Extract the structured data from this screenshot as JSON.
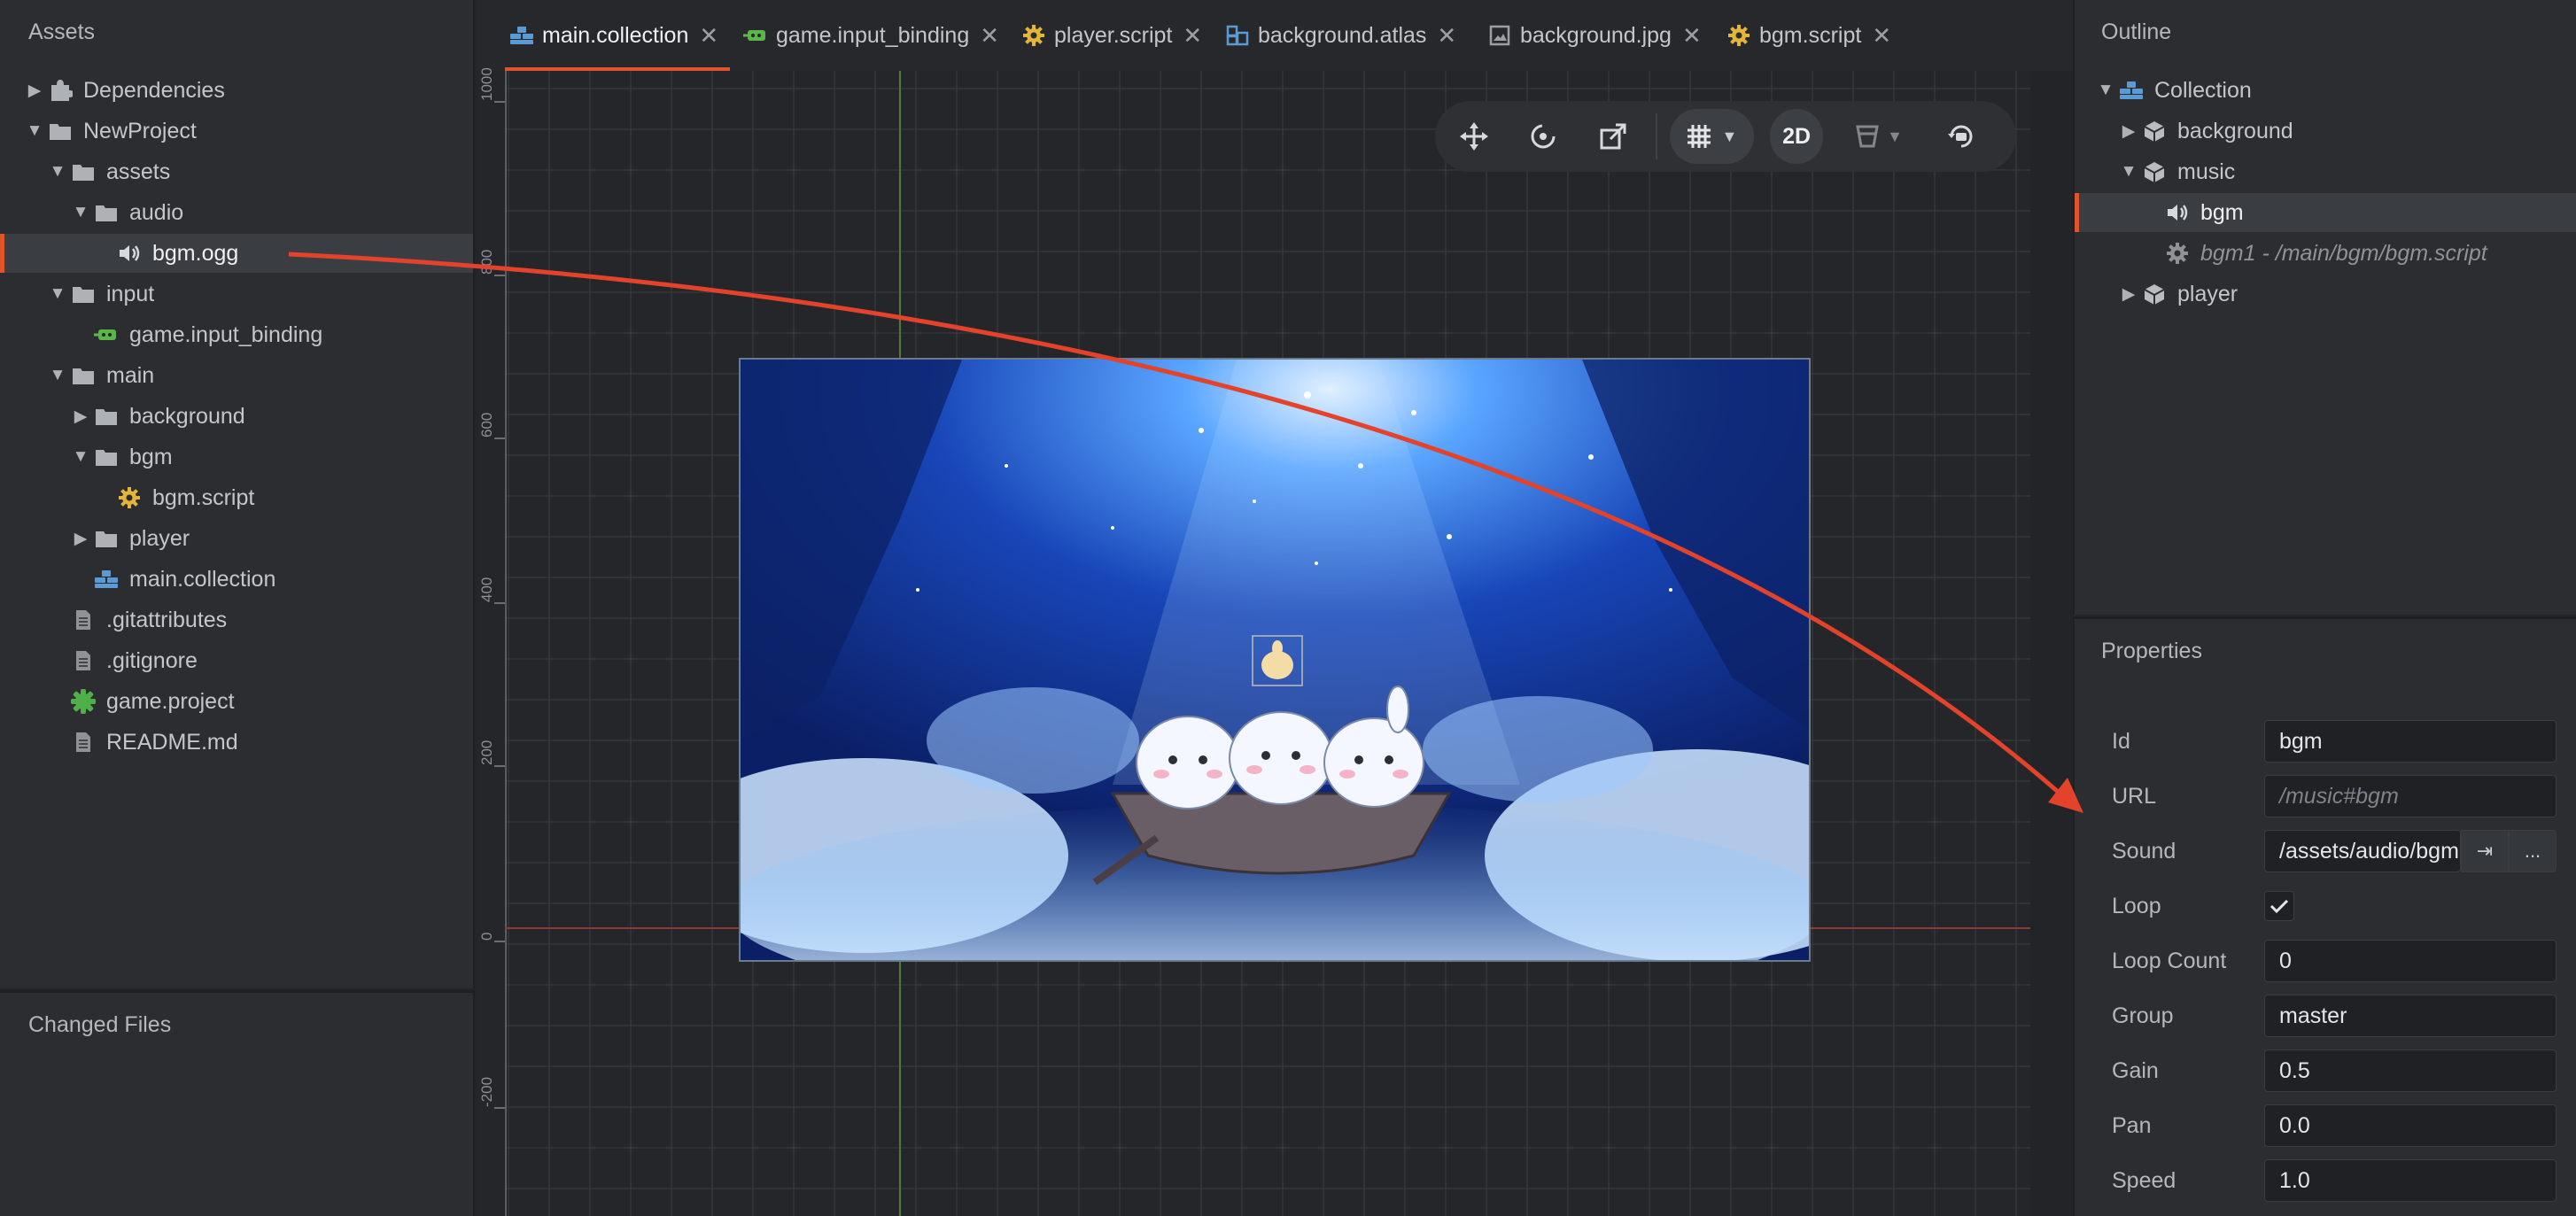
{
  "assets": {
    "title": "Assets",
    "items": [
      {
        "label": "Dependencies",
        "icon": "puzzle-icon",
        "twisty": "collapsed"
      },
      {
        "label": "NewProject",
        "icon": "folder-icon",
        "twisty": "expanded"
      },
      {
        "label": "assets",
        "icon": "folder-icon",
        "twisty": "expanded"
      },
      {
        "label": "audio",
        "icon": "folder-icon",
        "twisty": "expanded"
      },
      {
        "label": "bgm.ogg",
        "icon": "speaker-icon",
        "twisty": "none",
        "selected": true
      },
      {
        "label": "input",
        "icon": "folder-icon",
        "twisty": "expanded"
      },
      {
        "label": "game.input_binding",
        "icon": "input-binding-icon",
        "twisty": "none"
      },
      {
        "label": "main",
        "icon": "folder-icon",
        "twisty": "expanded"
      },
      {
        "label": "background",
        "icon": "folder-icon",
        "twisty": "collapsed"
      },
      {
        "label": "bgm",
        "icon": "folder-icon",
        "twisty": "expanded"
      },
      {
        "label": "bgm.script",
        "icon": "gear-icon",
        "twisty": "none"
      },
      {
        "label": "player",
        "icon": "folder-icon",
        "twisty": "collapsed"
      },
      {
        "label": "main.collection",
        "icon": "collection-icon",
        "twisty": "none"
      },
      {
        "label": ".gitattributes",
        "icon": "file-icon",
        "twisty": "none"
      },
      {
        "label": ".gitignore",
        "icon": "file-icon",
        "twisty": "none"
      },
      {
        "label": "game.project",
        "icon": "project-icon",
        "twisty": "none"
      },
      {
        "label": "README.md",
        "icon": "file-icon",
        "twisty": "none"
      }
    ]
  },
  "changed_files": {
    "title": "Changed Files"
  },
  "tabs": [
    {
      "label": "main.collection",
      "icon": "collection-icon",
      "active": true
    },
    {
      "label": "game.input_binding",
      "icon": "input-binding-icon"
    },
    {
      "label": "player.script",
      "icon": "gear-icon"
    },
    {
      "label": "background.atlas",
      "icon": "atlas-icon"
    },
    {
      "label": "background.jpg",
      "icon": "image-icon"
    },
    {
      "label": "bgm.script",
      "icon": "gear-icon"
    }
  ],
  "tab_close_glyph": "✕",
  "ruler": {
    "labels": [
      "1000",
      "800",
      "600",
      "400",
      "200",
      "0",
      "-200"
    ]
  },
  "toolbar": {
    "move_icon": "move-icon",
    "rotate_icon": "rotate-icon",
    "scale_icon": "scale-icon",
    "grid_icon": "grid-icon",
    "mode_label": "2D",
    "visibility_icon": "visibility-filter-icon",
    "camera_icon": "camera-reset-icon"
  },
  "outline": {
    "title": "Outline",
    "items": [
      {
        "label": "Collection",
        "icon": "collection-icon",
        "twisty": "expanded"
      },
      {
        "label": "background",
        "icon": "gameobject-icon",
        "twisty": "collapsed"
      },
      {
        "label": "music",
        "icon": "gameobject-icon",
        "twisty": "expanded"
      },
      {
        "label": "bgm",
        "icon": "speaker-icon",
        "twisty": "none",
        "selected": true
      },
      {
        "label": "bgm1 - /main/bgm/bgm.script",
        "icon": "gear-icon",
        "twisty": "none",
        "italic": true
      },
      {
        "label": "player",
        "icon": "gameobject-icon",
        "twisty": "collapsed"
      }
    ]
  },
  "properties": {
    "title": "Properties",
    "id": {
      "label": "Id",
      "value": "bgm"
    },
    "url": {
      "label": "URL",
      "value": "/music#bgm"
    },
    "sound": {
      "label": "Sound",
      "value": "/assets/audio/bgm.ogg",
      "goto_glyph": "⇥",
      "browse_label": "..."
    },
    "loop": {
      "label": "Loop",
      "checked": true
    },
    "loop_count": {
      "label": "Loop Count",
      "value": "0"
    },
    "group": {
      "label": "Group",
      "value": "master"
    },
    "gain": {
      "label": "Gain",
      "value": "0.5"
    },
    "pan": {
      "label": "Pan",
      "value": "0.0"
    },
    "speed": {
      "label": "Speed",
      "value": "1.0"
    }
  },
  "colors": {
    "accent": "#e0542c",
    "panel": "#2b2d31",
    "viewport": "#24262a",
    "folder": "#aeb2b7",
    "gear": "#e3b53a",
    "collection": "#5b9bd5",
    "input_binding": "#5cb54a",
    "project": "#4fb04a"
  }
}
